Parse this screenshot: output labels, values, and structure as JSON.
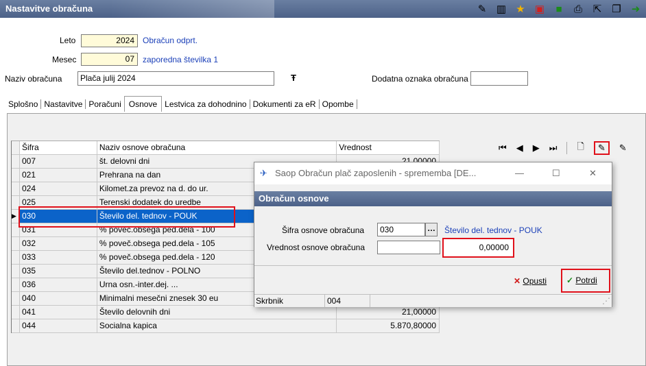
{
  "header": {
    "title": "Nastavitve obračuna"
  },
  "toolbar_icons": [
    "edit-icon",
    "columns-icon",
    "star-icon",
    "delete-icon",
    "cube-icon",
    "print-icon",
    "export-icon",
    "copy-icon",
    "exit-icon"
  ],
  "form": {
    "leto_label": "Leto",
    "leto_value": "2024",
    "leto_info": "Obračun odprt.",
    "mesec_label": "Mesec",
    "mesec_value": "07",
    "mesec_info": "zaporedna številka 1",
    "naziv_label": "Naziv obračuna",
    "naziv_value": "Plača julij 2024",
    "dodatna_label": "Dodatna oznaka obračuna",
    "dodatna_value": ""
  },
  "tabs": [
    "Splošno",
    "Nastavitve",
    "Poračuni",
    "Osnove",
    "Lestvica za dohodnino",
    "Dokumenti za eR",
    "Opombe"
  ],
  "active_tab": "Osnove",
  "table": {
    "headers": [
      "Šifra",
      "Naziv osnove obračuna",
      "Vrednost"
    ],
    "rows": [
      {
        "sifra": "007",
        "naziv": "št. delovni dni",
        "vrednost": "21,00000"
      },
      {
        "sifra": "021",
        "naziv": "Prehrana na dan",
        "vrednost": ""
      },
      {
        "sifra": "024",
        "naziv": "Kilomet.za prevoz na d. do ur.",
        "vrednost": ""
      },
      {
        "sifra": "025",
        "naziv": "Terenski dodatek do uredbe",
        "vrednost": ""
      },
      {
        "sifra": "030",
        "naziv": "Število del. tednov - POUK",
        "vrednost": ""
      },
      {
        "sifra": "031",
        "naziv": "% poveč.obsega ped.dela - 100",
        "vrednost": ""
      },
      {
        "sifra": "032",
        "naziv": "% poveč.obsega ped.dela - 105",
        "vrednost": ""
      },
      {
        "sifra": "033",
        "naziv": "% poveč.obsega ped.dela - 120",
        "vrednost": ""
      },
      {
        "sifra": "035",
        "naziv": "Število del.tednov - POLNO",
        "vrednost": ""
      },
      {
        "sifra": "036",
        "naziv": "Urna osn.-inter.dej. ...",
        "vrednost": ""
      },
      {
        "sifra": "040",
        "naziv": "Minimalni mesečni znesek 30 eu",
        "vrednost": ""
      },
      {
        "sifra": "041",
        "naziv": "Število delovnih dni",
        "vrednost": "21,00000"
      },
      {
        "sifra": "044",
        "naziv": "Socialna kapica",
        "vrednost": "5.870,80000"
      }
    ],
    "selected_index": 4
  },
  "dialog": {
    "window_title": "Saop Obračun plač zaposlenih - sprememba [DE...",
    "header": "Obračun osnove",
    "sifra_label": "Šifra osnove obračuna",
    "sifra_value": "030",
    "sifra_desc": "Število del. tednov - POUK",
    "vrednost_label": "Vrednost osnove obračuna",
    "vrednost_value": "0,00000",
    "cancel_label": "Opusti",
    "confirm_label": "Potrdi",
    "status_label": "Skrbnik",
    "status_value": "004"
  }
}
